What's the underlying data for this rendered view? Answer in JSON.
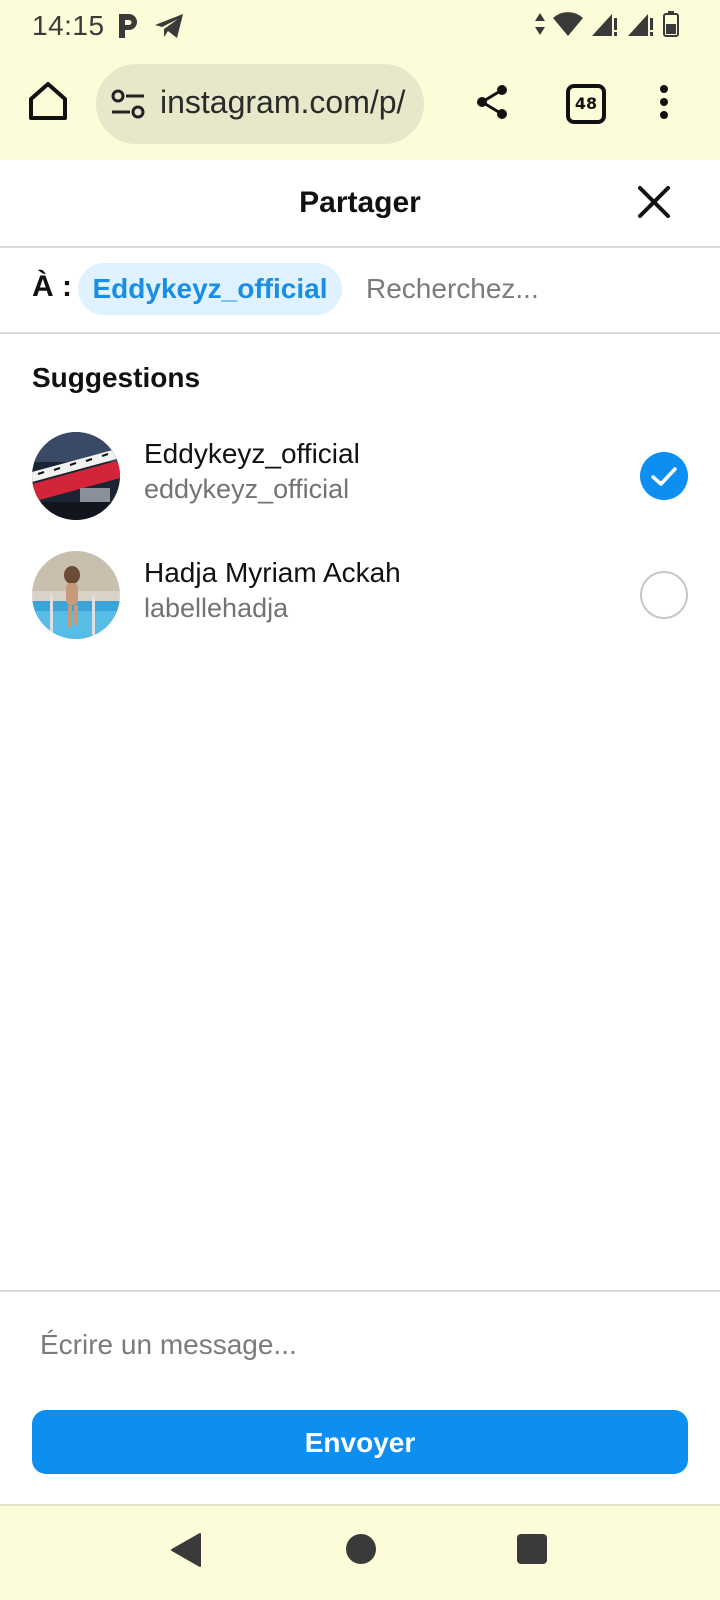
{
  "status_bar": {
    "time": "14:15",
    "icons_left": [
      "parking-icon",
      "telegram-icon"
    ],
    "icons_right": [
      "data-arrows-icon",
      "wifi-icon",
      "signal-icon",
      "signal-icon",
      "battery-icon"
    ]
  },
  "browser": {
    "url": "instagram.com/p/",
    "tab_count": "48"
  },
  "share_dialog": {
    "title": "Partager",
    "to_label": "À :",
    "selected_recipient": "Eddykeyz_official",
    "search_placeholder": "Recherchez...",
    "suggestions_heading": "Suggestions",
    "suggestions": [
      {
        "name": "Eddykeyz_official",
        "username": "eddykeyz_official",
        "selected": true
      },
      {
        "name": "Hadja Myriam Ackah",
        "username": "labellehadja",
        "selected": false
      }
    ],
    "message_placeholder": "Écrire un message...",
    "send_label": "Envoyer"
  },
  "colors": {
    "accent": "#0c8ff0",
    "chip_bg": "#e0f1ff",
    "chrome_bg": "#fcfdd8"
  }
}
